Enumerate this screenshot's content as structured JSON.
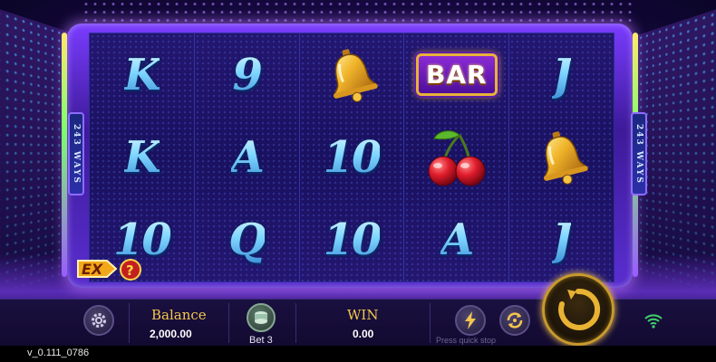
{
  "ways_label": "243 WAYS",
  "reels": [
    [
      {
        "type": "text",
        "label": "K"
      },
      {
        "type": "text",
        "label": "K"
      },
      {
        "type": "text",
        "label": "10"
      }
    ],
    [
      {
        "type": "text",
        "label": "9"
      },
      {
        "type": "text",
        "label": "A"
      },
      {
        "type": "text",
        "label": "Q"
      }
    ],
    [
      {
        "type": "icon",
        "icon": "bell-icon"
      },
      {
        "type": "text",
        "label": "10"
      },
      {
        "type": "text",
        "label": "10"
      }
    ],
    [
      {
        "type": "bar",
        "label": "BAR"
      },
      {
        "type": "icon",
        "icon": "cherry-icon"
      },
      {
        "type": "text",
        "label": "A"
      }
    ],
    [
      {
        "type": "text",
        "label": "J"
      },
      {
        "type": "icon",
        "icon": "bell-icon"
      },
      {
        "type": "text",
        "label": "J"
      }
    ]
  ],
  "ex_badge": {
    "label": "EX",
    "help": "?"
  },
  "bottom_bar": {
    "balance_label": "Balance",
    "balance_value": "2,000.00",
    "bet_label": "Bet 3",
    "win_label": "WIN",
    "win_value": "0.00",
    "hint": "Press quick stop"
  },
  "icons": [
    "settings-gear-icon",
    "chips-icon",
    "turbo-lightning-icon",
    "autospin-icon",
    "spin-arrow-icon",
    "wifi-icon"
  ],
  "colors": {
    "gold": "#f3c64b",
    "symbol_blue": "#7fd6ff",
    "reel_bg": "#1a1160"
  },
  "version": "v_0.111_0786"
}
